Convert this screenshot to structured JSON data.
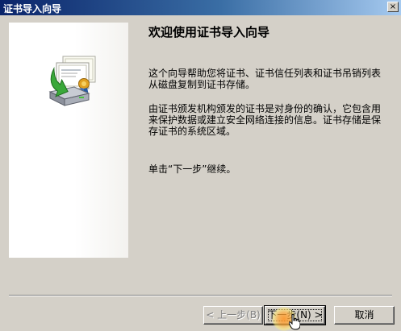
{
  "window": {
    "title": "证书导入向导",
    "close_glyph": "×"
  },
  "wizard": {
    "heading": "欢迎使用证书导入向导",
    "paragraph1": "这个向导帮助您将证书、证书信任列表和证书吊销列表从磁盘复制到证书存储。",
    "paragraph2": "由证书颁发机构颁发的证书是对身份的确认，它包含用来保护数据或建立安全网络连接的信息。证书存储是保存证书的系统区域。",
    "paragraph3": "单击“下一步”继续。"
  },
  "buttons": {
    "back": "< 上一步(B)",
    "next": "下一步(N) >",
    "cancel": "取消"
  },
  "icons": {
    "banner": "certificate-import-icon",
    "cursor": "hand-pointer-icon"
  },
  "colors": {
    "titlebar_start": "#0a246a",
    "titlebar_end": "#a6caf0",
    "dialog_background": "#d4d0c8",
    "click_highlight": "#ff9628"
  }
}
